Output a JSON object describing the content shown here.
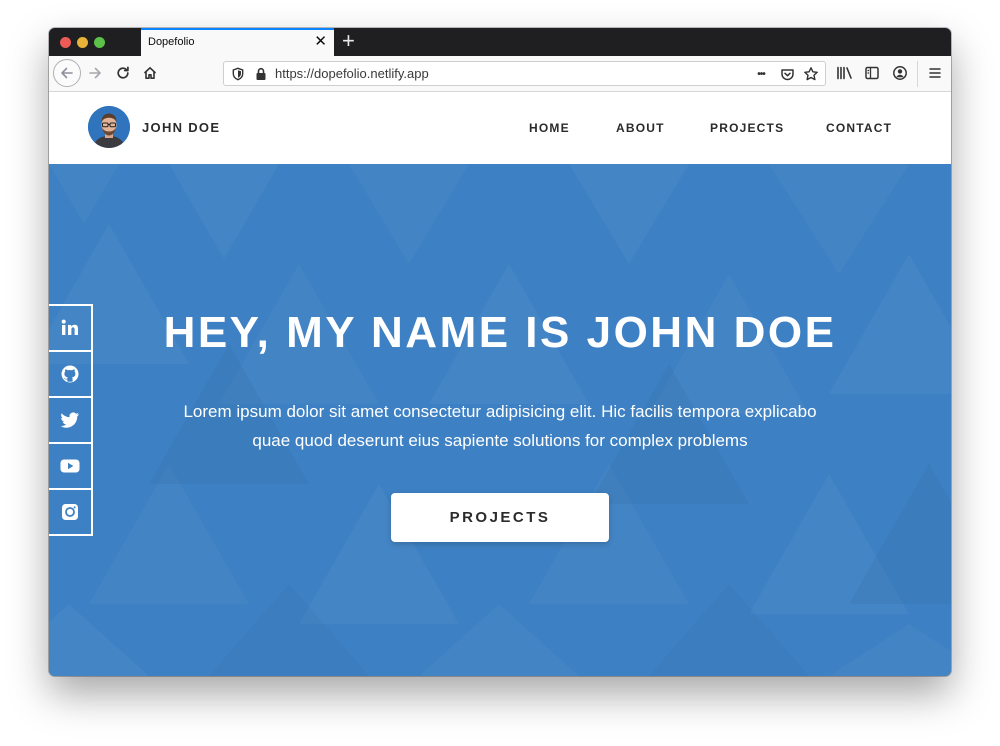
{
  "browser": {
    "tab_title": "Dopefolio",
    "tab_close": "✕",
    "new_tab": "+",
    "url": "https://dopefolio.netlify.app",
    "more_dots": "•••"
  },
  "site": {
    "brand_name": "JOHN DOE",
    "menu": [
      "HOME",
      "ABOUT",
      "PROJECTS",
      "CONTACT"
    ]
  },
  "hero": {
    "title": "HEY, MY NAME IS JOHN DOE",
    "subtitle": "Lorem ipsum dolor sit amet consectetur adipisicing elit. Hic facilis tempora explicabo quae quod deserunt eius sapiente solutions for complex problems",
    "button_label": "PROJECTS"
  },
  "social_icons": [
    "linkedin-icon",
    "github-icon",
    "twitter-icon",
    "youtube-icon",
    "instagram-icon"
  ],
  "colors": {
    "hero_bg": "#3d80c3",
    "tab_accent": "#0a84ff",
    "text_dark": "#2b2b2b"
  }
}
